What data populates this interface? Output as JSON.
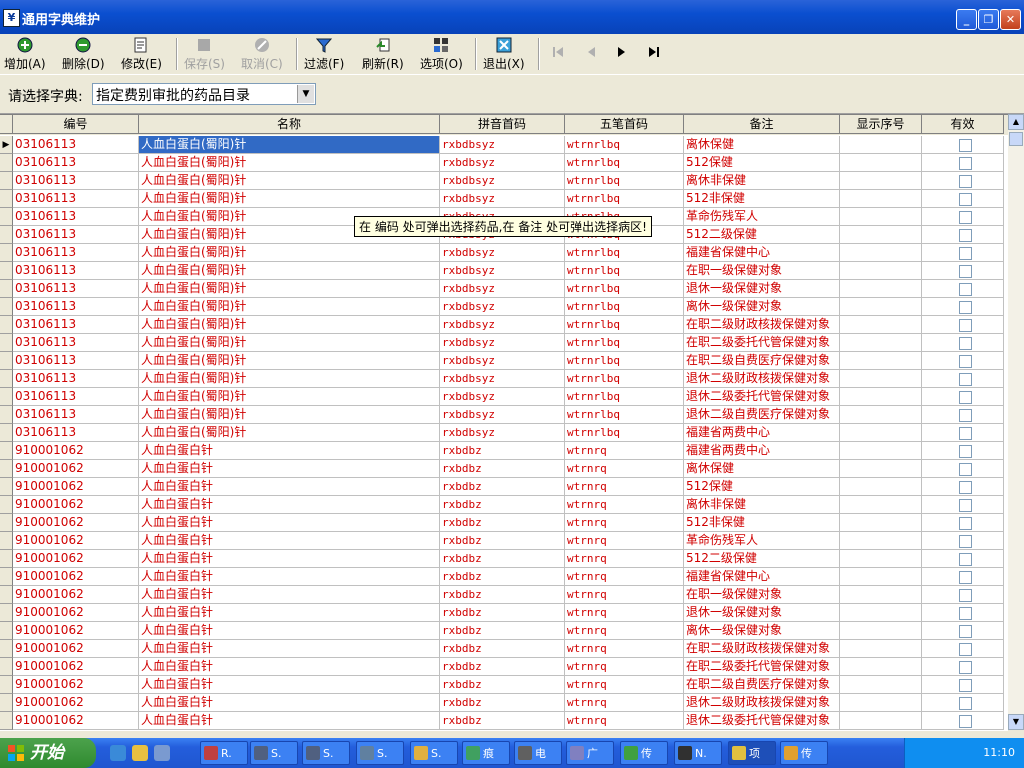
{
  "window": {
    "title": "通用字典维护"
  },
  "toolbar": {
    "buttons": [
      {
        "label": "增加(A)",
        "icon": "plus-icon",
        "enabled": true
      },
      {
        "label": "删除(D)",
        "icon": "minus-icon",
        "enabled": true
      },
      {
        "label": "修改(E)",
        "icon": "edit-icon",
        "enabled": true
      },
      {
        "label": "保存(S)",
        "icon": "save-icon",
        "enabled": false
      },
      {
        "label": "取消(C)",
        "icon": "cancel-icon",
        "enabled": false
      },
      {
        "label": "过滤(F)",
        "icon": "filter-icon",
        "enabled": true
      },
      {
        "label": "刷新(R)",
        "icon": "refresh-icon",
        "enabled": true
      },
      {
        "label": "选项(O)",
        "icon": "options-icon",
        "enabled": true
      },
      {
        "label": "退出(X)",
        "icon": "exit-icon",
        "enabled": true
      }
    ],
    "nav": [
      "first-record-icon",
      "prev-record-icon",
      "next-record-icon",
      "last-record-icon"
    ]
  },
  "selector": {
    "label": "请选择字典:",
    "value": "指定费别审批的药品目录"
  },
  "grid": {
    "columns": [
      "编号",
      "名称",
      "拼音首码",
      "五笔首码",
      "备注",
      "显示序号",
      "有效"
    ],
    "rows": [
      [
        "03106113",
        "人血白蛋白(蜀阳)针",
        "rxbdbsyz",
        "wtrnrlbq",
        "离休保健",
        "",
        ""
      ],
      [
        "03106113",
        "人血白蛋白(蜀阳)针",
        "rxbdbsyz",
        "wtrnrlbq",
        "512保健",
        "",
        ""
      ],
      [
        "03106113",
        "人血白蛋白(蜀阳)针",
        "rxbdbsyz",
        "wtrnrlbq",
        "离休非保健",
        "",
        ""
      ],
      [
        "03106113",
        "人血白蛋白(蜀阳)针",
        "rxbdbsyz",
        "wtrnrlbq",
        "512非保健",
        "",
        ""
      ],
      [
        "03106113",
        "人血白蛋白(蜀阳)针",
        "rxbdbsyz",
        "wtrnrlbq",
        "革命伤残军人",
        "",
        ""
      ],
      [
        "03106113",
        "人血白蛋白(蜀阳)针",
        "rxbdbsyz",
        "wtrnrlbq",
        "512二级保健",
        "",
        ""
      ],
      [
        "03106113",
        "人血白蛋白(蜀阳)针",
        "rxbdbsyz",
        "wtrnrlbq",
        "福建省保健中心",
        "",
        ""
      ],
      [
        "03106113",
        "人血白蛋白(蜀阳)针",
        "rxbdbsyz",
        "wtrnrlbq",
        "在职一级保健对象",
        "",
        ""
      ],
      [
        "03106113",
        "人血白蛋白(蜀阳)针",
        "rxbdbsyz",
        "wtrnrlbq",
        "退休一级保健对象",
        "",
        ""
      ],
      [
        "03106113",
        "人血白蛋白(蜀阳)针",
        "rxbdbsyz",
        "wtrnrlbq",
        "离休一级保健对象",
        "",
        ""
      ],
      [
        "03106113",
        "人血白蛋白(蜀阳)针",
        "rxbdbsyz",
        "wtrnrlbq",
        "在职二级财政核拨保健对象",
        "",
        ""
      ],
      [
        "03106113",
        "人血白蛋白(蜀阳)针",
        "rxbdbsyz",
        "wtrnrlbq",
        "在职二级委托代管保健对象",
        "",
        ""
      ],
      [
        "03106113",
        "人血白蛋白(蜀阳)针",
        "rxbdbsyz",
        "wtrnrlbq",
        "在职二级自费医疗保健对象",
        "",
        ""
      ],
      [
        "03106113",
        "人血白蛋白(蜀阳)针",
        "rxbdbsyz",
        "wtrnrlbq",
        "退休二级财政核拨保健对象",
        "",
        ""
      ],
      [
        "03106113",
        "人血白蛋白(蜀阳)针",
        "rxbdbsyz",
        "wtrnrlbq",
        "退休二级委托代管保健对象",
        "",
        ""
      ],
      [
        "03106113",
        "人血白蛋白(蜀阳)针",
        "rxbdbsyz",
        "wtrnrlbq",
        "退休二级自费医疗保健对象",
        "",
        ""
      ],
      [
        "03106113",
        "人血白蛋白(蜀阳)针",
        "rxbdbsyz",
        "wtrnrlbq",
        "福建省两费中心",
        "",
        ""
      ],
      [
        "910001062",
        "人血白蛋白针",
        "rxbdbz",
        "wtrnrq",
        "福建省两费中心",
        "",
        ""
      ],
      [
        "910001062",
        "人血白蛋白针",
        "rxbdbz",
        "wtrnrq",
        "离休保健",
        "",
        ""
      ],
      [
        "910001062",
        "人血白蛋白针",
        "rxbdbz",
        "wtrnrq",
        "512保健",
        "",
        ""
      ],
      [
        "910001062",
        "人血白蛋白针",
        "rxbdbz",
        "wtrnrq",
        "离休非保健",
        "",
        ""
      ],
      [
        "910001062",
        "人血白蛋白针",
        "rxbdbz",
        "wtrnrq",
        "512非保健",
        "",
        ""
      ],
      [
        "910001062",
        "人血白蛋白针",
        "rxbdbz",
        "wtrnrq",
        "革命伤残军人",
        "",
        ""
      ],
      [
        "910001062",
        "人血白蛋白针",
        "rxbdbz",
        "wtrnrq",
        "512二级保健",
        "",
        ""
      ],
      [
        "910001062",
        "人血白蛋白针",
        "rxbdbz",
        "wtrnrq",
        "福建省保健中心",
        "",
        ""
      ],
      [
        "910001062",
        "人血白蛋白针",
        "rxbdbz",
        "wtrnrq",
        "在职一级保健对象",
        "",
        ""
      ],
      [
        "910001062",
        "人血白蛋白针",
        "rxbdbz",
        "wtrnrq",
        "退休一级保健对象",
        "",
        ""
      ],
      [
        "910001062",
        "人血白蛋白针",
        "rxbdbz",
        "wtrnrq",
        "离休一级保健对象",
        "",
        ""
      ],
      [
        "910001062",
        "人血白蛋白针",
        "rxbdbz",
        "wtrnrq",
        "在职二级财政核拨保健对象",
        "",
        ""
      ],
      [
        "910001062",
        "人血白蛋白针",
        "rxbdbz",
        "wtrnrq",
        "在职二级委托代管保健对象",
        "",
        ""
      ],
      [
        "910001062",
        "人血白蛋白针",
        "rxbdbz",
        "wtrnrq",
        "在职二级自费医疗保健对象",
        "",
        ""
      ],
      [
        "910001062",
        "人血白蛋白针",
        "rxbdbz",
        "wtrnrq",
        "退休二级财政核拨保健对象",
        "",
        ""
      ],
      [
        "910001062",
        "人血白蛋白针",
        "rxbdbz",
        "wtrnrq",
        "退休二级委托代管保健对象",
        "",
        ""
      ]
    ]
  },
  "tooltip": {
    "text": "在 编码 处可弹出选择药品,在 备注 处可弹出选择病区!"
  },
  "taskbar": {
    "start_label": "开始",
    "tasks": [
      "R.",
      "S.",
      "S.",
      "S.",
      "S.",
      "痕",
      "电",
      "广",
      "传",
      "N.",
      "项",
      "传"
    ],
    "clock": "11:10"
  }
}
